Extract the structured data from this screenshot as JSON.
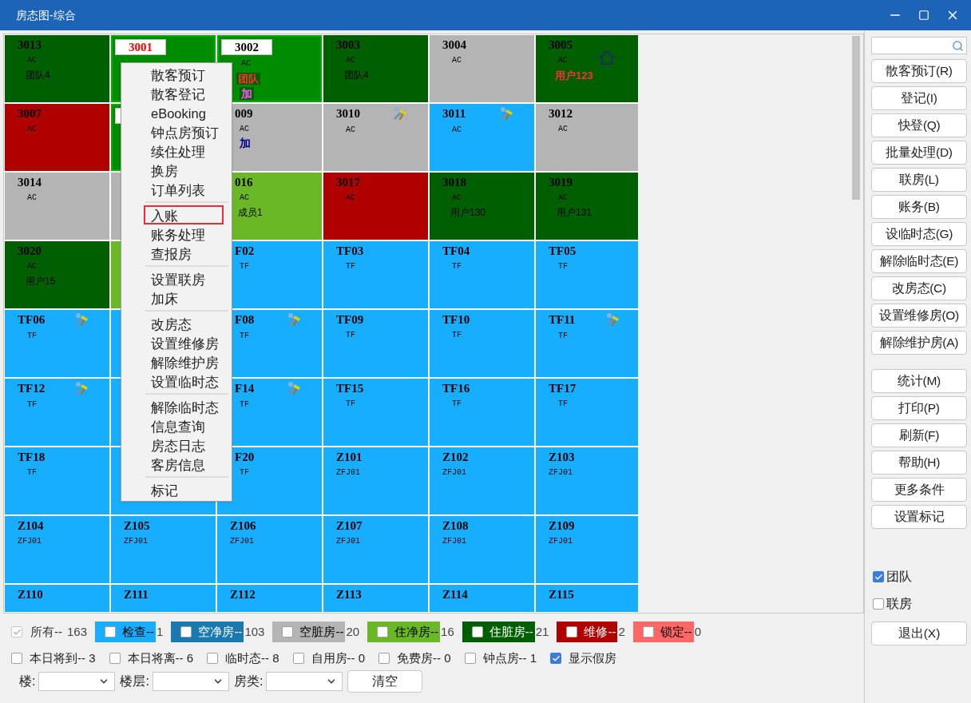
{
  "window": {
    "title": "房态图-综合"
  },
  "rooms": [
    [
      {
        "kind": "normal",
        "number": "3013",
        "color": "#005f00",
        "type": "AC",
        "guest": "团队4"
      },
      {
        "kind": "boxed",
        "number": "3001",
        "number_alert": true,
        "color": "#008c00"
      },
      {
        "kind": "boxed",
        "number": "3002",
        "color": "#008c00",
        "type": "AC",
        "guest": "团队",
        "guest_alert": true,
        "extra": "加",
        "extra_highlight": true
      },
      {
        "kind": "normal",
        "number": "3003",
        "color": "#005f00",
        "type": "AC",
        "guest": "团队4"
      },
      {
        "kind": "normal",
        "number": "3004",
        "color": "#b4b4b4",
        "type": "AC"
      },
      {
        "kind": "normal",
        "number": "3005",
        "color": "#005f00",
        "type": "AC",
        "home_flag": true,
        "guest": "用户123",
        "guest_alert": true
      }
    ],
    [
      {
        "kind": "normal",
        "number": "3007",
        "color": "#b00000",
        "type": "AC"
      },
      {
        "kind": "boxed",
        "color": "#008c00"
      },
      {
        "kind": "clipped",
        "number": "009",
        "color": "#b4b4b4",
        "type": "AC",
        "extra": "加",
        "extra_highlight": false
      },
      {
        "kind": "normal",
        "number": "3010",
        "color": "#b4b4b4",
        "type": "AC",
        "repair_flag": true
      },
      {
        "kind": "normal",
        "number": "3011",
        "color": "#17aeff",
        "type": "AC",
        "repair_flag": true
      },
      {
        "kind": "normal",
        "number": "3012",
        "color": "#b4b4b4",
        "type": "AC"
      }
    ],
    [
      {
        "kind": "normal",
        "number": "3014",
        "color": "#b4b4b4",
        "type": "AC"
      },
      {
        "kind": "covered",
        "color": "#b4b4b4"
      },
      {
        "kind": "clipped",
        "number": "016",
        "color": "#6ab826",
        "type": "AC",
        "guest": "成员1"
      },
      {
        "kind": "normal",
        "number": "3017",
        "color": "#b00000",
        "type": "AC"
      },
      {
        "kind": "normal",
        "number": "3018",
        "color": "#005f00",
        "type": "AC",
        "guest": "用户130"
      },
      {
        "kind": "normal",
        "number": "3019",
        "color": "#005f00",
        "type": "AC",
        "guest": "用户131"
      }
    ],
    [
      {
        "kind": "normal",
        "number": "3020",
        "color": "#005f00",
        "type": "AC",
        "guest": "用户15"
      },
      {
        "kind": "covered",
        "color": "#6ab826"
      },
      {
        "kind": "clipped",
        "number": "F02",
        "color": "#17aeff",
        "type": "TF"
      },
      {
        "kind": "normal",
        "number": "TF03",
        "color": "#17aeff",
        "type": "TF"
      },
      {
        "kind": "normal",
        "number": "TF04",
        "color": "#17aeff",
        "type": "TF"
      },
      {
        "kind": "normal",
        "number": "TF05",
        "color": "#17aeff",
        "type": "TF"
      }
    ],
    [
      {
        "kind": "normal",
        "number": "TF06",
        "color": "#17aeff",
        "type": "TF",
        "repair_flag": true
      },
      {
        "kind": "covered",
        "color": "#17aeff"
      },
      {
        "kind": "clipped",
        "number": "F08",
        "color": "#17aeff",
        "type": "TF",
        "repair_flag": true
      },
      {
        "kind": "normal",
        "number": "TF09",
        "color": "#17aeff",
        "type": "TF"
      },
      {
        "kind": "normal",
        "number": "TF10",
        "color": "#17aeff",
        "type": "TF"
      },
      {
        "kind": "normal",
        "number": "TF11",
        "color": "#17aeff",
        "type": "TF",
        "repair_flag": true
      }
    ],
    [
      {
        "kind": "normal",
        "number": "TF12",
        "color": "#17aeff",
        "type": "TF",
        "repair_flag": true
      },
      {
        "kind": "covered",
        "color": "#17aeff"
      },
      {
        "kind": "clipped",
        "number": "F14",
        "color": "#17aeff",
        "type": "TF",
        "repair_flag": true
      },
      {
        "kind": "normal",
        "number": "TF15",
        "color": "#17aeff",
        "type": "TF"
      },
      {
        "kind": "normal",
        "number": "TF16",
        "color": "#17aeff",
        "type": "TF"
      },
      {
        "kind": "normal",
        "number": "TF17",
        "color": "#17aeff",
        "type": "TF"
      }
    ],
    [
      {
        "kind": "normal",
        "number": "TF18",
        "color": "#17aeff",
        "type": "TF"
      },
      {
        "kind": "covered",
        "color": "#17aeff"
      },
      {
        "kind": "clipped",
        "number": "F20",
        "color": "#17aeff",
        "type": "TF"
      },
      {
        "kind": "normal",
        "number": "Z101",
        "color": "#17aeff",
        "type": "ZFJ01"
      },
      {
        "kind": "normal",
        "number": "Z102",
        "color": "#17aeff",
        "type": "ZFJ01"
      },
      {
        "kind": "normal",
        "number": "Z103",
        "color": "#17aeff",
        "type": "ZFJ01"
      }
    ],
    [
      {
        "kind": "normal",
        "number": "Z104",
        "color": "#17aeff",
        "type": "ZFJ01"
      },
      {
        "kind": "normal",
        "number": "Z105",
        "color": "#17aeff",
        "type": "ZFJ01"
      },
      {
        "kind": "normal",
        "number": "Z106",
        "color": "#17aeff",
        "type": "ZFJ01"
      },
      {
        "kind": "normal",
        "number": "Z107",
        "color": "#17aeff",
        "type": "ZFJ01"
      },
      {
        "kind": "normal",
        "number": "Z108",
        "color": "#17aeff",
        "type": "ZFJ01"
      },
      {
        "kind": "normal",
        "number": "Z109",
        "color": "#17aeff",
        "type": "ZFJ01"
      }
    ],
    [
      {
        "kind": "normal",
        "number": "Z110",
        "color": "#17aeff"
      },
      {
        "kind": "normal",
        "number": "Z111",
        "color": "#17aeff"
      },
      {
        "kind": "normal",
        "number": "Z112",
        "color": "#17aeff"
      },
      {
        "kind": "normal",
        "number": "Z113",
        "color": "#17aeff"
      },
      {
        "kind": "normal",
        "number": "Z114",
        "color": "#17aeff"
      },
      {
        "kind": "normal",
        "number": "Z115",
        "color": "#17aeff"
      }
    ]
  ],
  "context_menu": [
    [
      {
        "label": "散客预订",
        "selected": false
      },
      {
        "label": "散客登记",
        "selected": false
      },
      {
        "label": "eBooking",
        "selected": false
      },
      {
        "label": "钟点房预订",
        "selected": false
      },
      {
        "label": "续住处理",
        "selected": false
      },
      {
        "label": "换房",
        "selected": false
      },
      {
        "label": "订单列表",
        "selected": false
      }
    ],
    [
      {
        "label": "入账",
        "selected": true
      },
      {
        "label": "账务处理",
        "selected": false
      },
      {
        "label": "查报房",
        "selected": false
      }
    ],
    [
      {
        "label": "设置联房",
        "selected": false
      },
      {
        "label": "加床",
        "selected": false
      }
    ],
    [
      {
        "label": "改房态",
        "selected": false
      },
      {
        "label": "设置维修房",
        "selected": false
      },
      {
        "label": "解除维护房",
        "selected": false
      },
      {
        "label": "设置临时态",
        "selected": false
      }
    ],
    [
      {
        "label": "解除临时态",
        "selected": false
      },
      {
        "label": "信息查询",
        "selected": false
      },
      {
        "label": "房态日志",
        "selected": false
      },
      {
        "label": "客房信息",
        "selected": false
      }
    ],
    [
      {
        "label": "标记",
        "selected": false
      }
    ]
  ],
  "legend": {
    "all": {
      "label": "所有--",
      "count": "163",
      "checked": true,
      "disabled": true
    },
    "statuses": [
      {
        "label": "检查--",
        "count": "1",
        "color": "#17aeff",
        "checked": false
      },
      {
        "label": "空净房--",
        "count": "103",
        "color": "#1a7ab0",
        "checked": false
      },
      {
        "label": "空脏房--",
        "count": "20",
        "color": "#b4b4b4",
        "checked": false
      },
      {
        "label": "住净房--",
        "count": "16",
        "color": "#6ab826",
        "checked": false
      },
      {
        "label": "住脏房--",
        "count": "21",
        "color": "#005f00",
        "checked": false
      },
      {
        "label": "维修--",
        "count": "2",
        "color": "#b00000",
        "checked": false
      },
      {
        "label": "锁定--",
        "count": "0",
        "color": "#ff6666",
        "checked": false
      }
    ]
  },
  "flags": [
    {
      "label": "本日将到-- 3",
      "checked": false
    },
    {
      "label": "本日将离-- 6",
      "checked": false
    },
    {
      "label": "临时态-- 8",
      "checked": false
    },
    {
      "label": "自用房-- 0",
      "checked": false
    },
    {
      "label": "免费房-- 0",
      "checked": false
    },
    {
      "label": "钟点房-- 1",
      "checked": false
    },
    {
      "label": "显示假房",
      "checked": true
    }
  ],
  "filters": [
    {
      "label": "楼:"
    },
    {
      "label": "楼层:"
    },
    {
      "label": "房类:"
    }
  ],
  "clear_button": "清空",
  "sidebar": {
    "action_groups": [
      [
        "散客预订(R)",
        "登记(I)",
        "快登(Q)",
        "批量处理(D)",
        "联房(L)",
        "账务(B)",
        "设临时态(G)",
        "解除临时态(E)",
        "改房态(C)",
        "设置维修房(O)",
        "解除维护房(A)"
      ],
      [
        "统计(M)",
        "打印(P)",
        "刷新(F)",
        "帮助(H)",
        "更多条件",
        "设置标记"
      ]
    ],
    "options": [
      {
        "label": "团队",
        "checked": true
      },
      {
        "label": "联房",
        "checked": false
      }
    ],
    "exit_button": "退出(X)"
  }
}
